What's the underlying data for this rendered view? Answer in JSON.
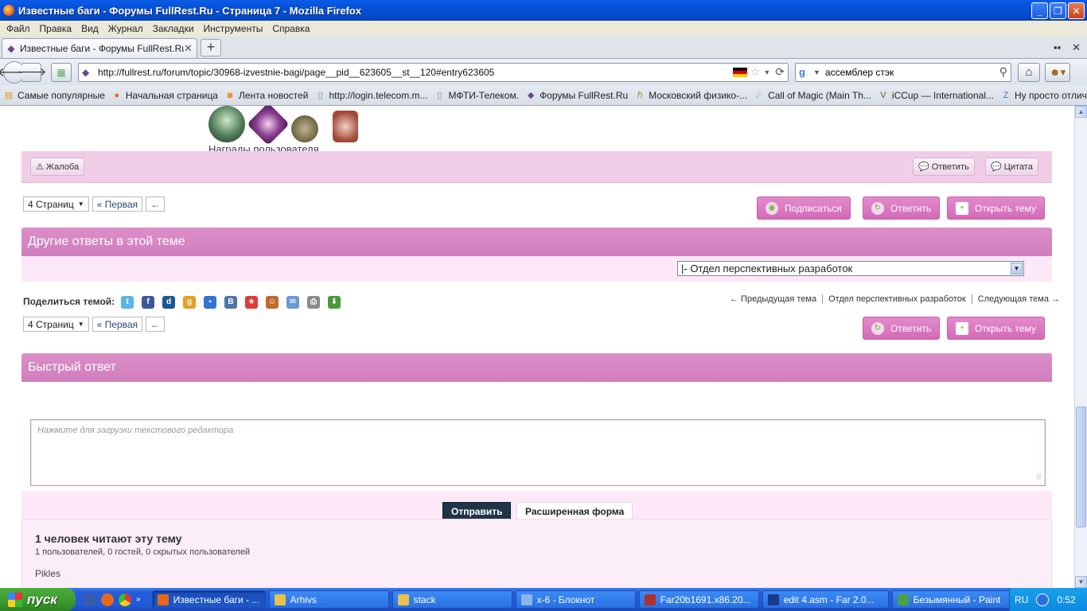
{
  "window": {
    "title": "Известные баги - Форумы FullRest.Ru - Страница 7 - Mozilla Firefox",
    "min_glyph": "_",
    "max_glyph": "❐",
    "close_glyph": "✕"
  },
  "menu": [
    "Файл",
    "Правка",
    "Вид",
    "Журнал",
    "Закладки",
    "Инструменты",
    "Справка"
  ],
  "tab": {
    "label": "Известные баги - Форумы FullRest.Ru -...",
    "close_glyph": "✕",
    "new_glyph": "+"
  },
  "nav": {
    "url": "http://fullrest.ru/forum/topic/30968-izvestnie-bagi/page__pid__623605__st__120#entry623605",
    "search_value": "ассемблер стэк"
  },
  "bookmarks": [
    {
      "label": "Самые популярные",
      "icon": "folder-icon",
      "color": "#d9a21b"
    },
    {
      "label": "Начальная страница",
      "icon": "firefox-icon",
      "color": "#e8671a"
    },
    {
      "label": "Лента новостей",
      "icon": "rss-icon",
      "color": "#e88a1a"
    },
    {
      "label": "http://login.telecom.m...",
      "icon": "page-icon",
      "color": "#888888"
    },
    {
      "label": "МФТИ-Телеком.",
      "icon": "page-icon",
      "color": "#888888"
    },
    {
      "label": "Форумы FullRest.Ru",
      "icon": "fullrest-icon",
      "color": "#6b4b8a"
    },
    {
      "label": "Московский физико-...",
      "icon": "mipt-icon",
      "color": "#b08a2a"
    },
    {
      "label": "Call of Magic (Main Th...",
      "icon": "com-icon",
      "color": "#777777"
    },
    {
      "label": "iCCup — International...",
      "icon": "iccup-icon",
      "color": "#7a5a2a"
    },
    {
      "label": "Ну просто отличная ...",
      "icon": "z-icon",
      "color": "#3a7ae0"
    }
  ],
  "awards": {
    "link": "Награды пользователя"
  },
  "post_bar": {
    "report": "Жалоба",
    "reply": "Ответить",
    "quote": "Цитата"
  },
  "pager": {
    "pages": "4 Страниц",
    "first": "« Первая",
    "prev": "←"
  },
  "actions": {
    "subscribe": "Подписаться",
    "reply": "Ответить",
    "open_topic": "Открыть тему"
  },
  "other_replies": {
    "header": "Другие ответы в этой теме",
    "forum_select": "|- Отдел перспективных разработок",
    "share_label": "Поделиться темой:",
    "prev_topic": "← Предыдущая тема",
    "forum_link": "Отдел перспективных разработок",
    "next_topic": "Следующая тема →"
  },
  "share_icons": [
    {
      "name": "twitter-icon",
      "glyph": "t",
      "color": "#5bb6e6"
    },
    {
      "name": "facebook-icon",
      "glyph": "f",
      "color": "#3b5998"
    },
    {
      "name": "digg-icon",
      "glyph": "d",
      "color": "#1b5891"
    },
    {
      "name": "google-icon",
      "glyph": "g",
      "color": "#e8a020"
    },
    {
      "name": "delicious-icon",
      "glyph": "▪",
      "color": "#3274d0"
    },
    {
      "name": "vkontakte-icon",
      "glyph": "B",
      "color": "#4a76a8"
    },
    {
      "name": "mail-ru-icon",
      "glyph": "★",
      "color": "#e03a3a"
    },
    {
      "name": "moikrug-icon",
      "glyph": "☺",
      "color": "#c46a2a"
    },
    {
      "name": "email-icon",
      "glyph": "✉",
      "color": "#6a9ad0"
    },
    {
      "name": "print-icon",
      "glyph": "⎙",
      "color": "#8a8a8a"
    },
    {
      "name": "download-icon",
      "glyph": "⬇",
      "color": "#4a9a3a"
    }
  ],
  "quick_reply": {
    "header": "Быстрый ответ",
    "placeholder": "Нажмите для загрузки текстового редактора",
    "submit": "Отправить",
    "advanced": "Расширенная форма"
  },
  "readers": {
    "title": "1 человек читают эту тему",
    "subtitle": "1 пользователей, 0 гостей, 0 скрытых пользователей",
    "user": "Pikles"
  },
  "taskbar": {
    "start": "пуск",
    "tasks": [
      {
        "label": "Известные баги - ...",
        "color": "#e8671a",
        "active": true
      },
      {
        "label": "Arhivs",
        "color": "#e8c24a",
        "active": false
      },
      {
        "label": "stack",
        "color": "#e8c24a",
        "active": false
      },
      {
        "label": "x-6 - Блокнот",
        "color": "#8ab4e8",
        "active": false
      },
      {
        "label": "Far20b1691.x86.20...",
        "color": "#b03030",
        "active": false
      },
      {
        "label": "edit 4.asm - Far 2.0...",
        "color": "#1a3a8a",
        "active": false
      },
      {
        "label": "Безымянный - Paint",
        "color": "#4aa04a",
        "active": false
      }
    ],
    "lang": "RU",
    "time": "0:52"
  },
  "colors": {
    "pink_bar": "#f2cde7",
    "pink_header": "#d07ebc",
    "pink_button": "#d46ab8",
    "pink_panel": "#fde8f7",
    "dark_button": "#1e3448"
  }
}
